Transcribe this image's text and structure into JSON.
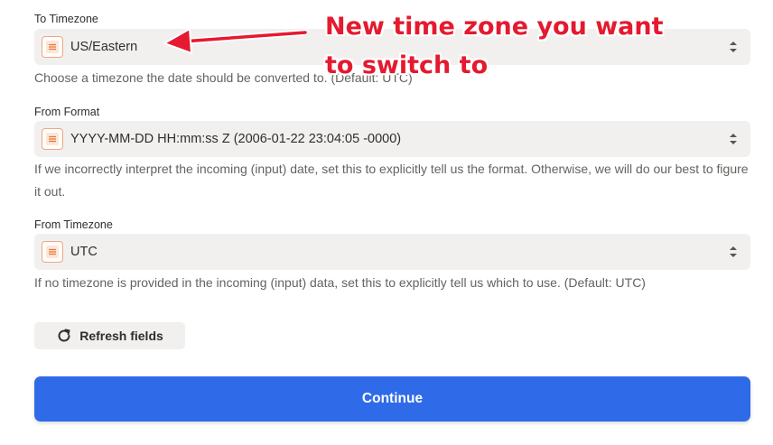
{
  "fields": [
    {
      "label": "To Timezone",
      "value": "US/Eastern",
      "help": "Choose a timezone the date should be converted to. (Default: UTC)"
    },
    {
      "label": "From Format",
      "value": "YYYY-MM-DD HH:mm:ss Z (2006-01-22 23:04:05 -0000)",
      "help": "If we incorrectly interpret the incoming (input) date, set this to explicitly tell us the format. Otherwise, we will do our best to figure it out."
    },
    {
      "label": "From Timezone",
      "value": "UTC",
      "help": "If no timezone is provided in the incoming (input) data, set this to explicitly tell us which to use. (Default: UTC)"
    }
  ],
  "refresh_label": "Refresh fields",
  "continue_label": "Continue",
  "annotation": {
    "text": "New time zone you want to switch to",
    "color": "#e5192f"
  },
  "colors": {
    "primary_button": "#2f6be8",
    "field_background": "#f1f0ef",
    "app_icon_accent": "#f3a57c"
  },
  "icons": {
    "app": "formatter-app-icon",
    "select": "chevron-up-down-icon",
    "refresh": "refresh-icon"
  }
}
